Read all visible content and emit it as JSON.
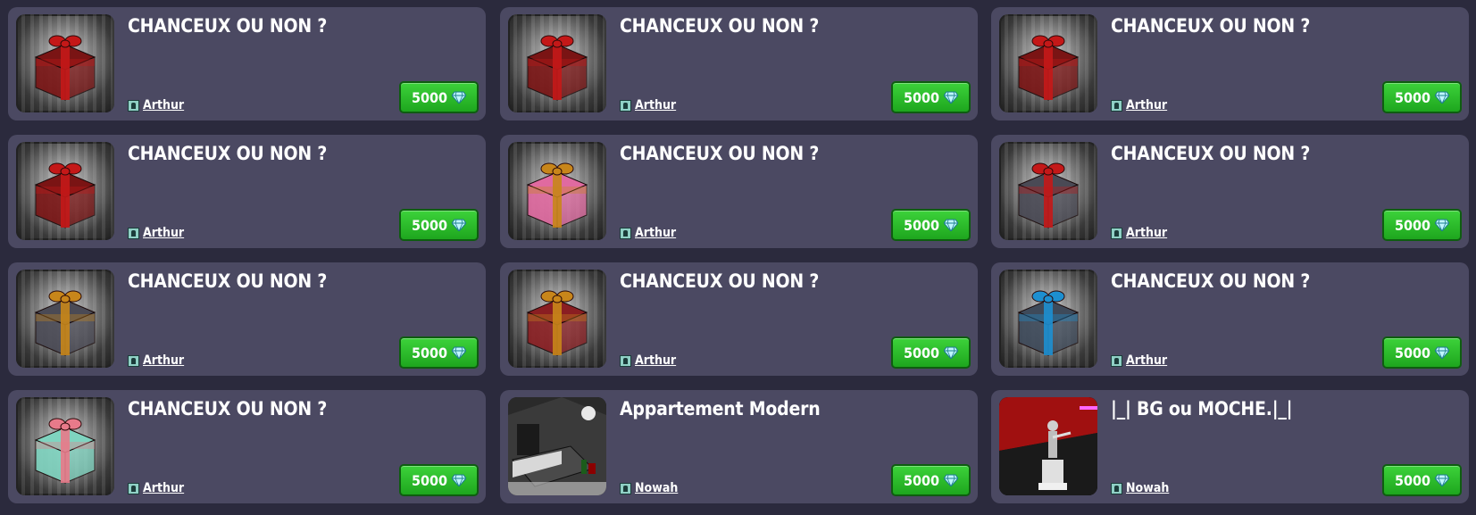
{
  "currency_icon": "diamond-icon",
  "author_icon": "user-icon",
  "cards": [
    {
      "title": "CHANCEUX OU NON ?",
      "author": "Arthur",
      "price": "5000",
      "image": "red-gift-icon",
      "box": "#7a1414",
      "ribbon": "#c41818"
    },
    {
      "title": "CHANCEUX OU NON ?",
      "author": "Arthur",
      "price": "5000",
      "image": "red-gift-icon",
      "box": "#7a1414",
      "ribbon": "#c41818"
    },
    {
      "title": "CHANCEUX OU NON ?",
      "author": "Arthur",
      "price": "5000",
      "image": "red-gift-icon",
      "box": "#7a1414",
      "ribbon": "#c41818"
    },
    {
      "title": "CHANCEUX OU NON ?",
      "author": "Arthur",
      "price": "5000",
      "image": "red-gift-icon",
      "box": "#7a1414",
      "ribbon": "#c41818"
    },
    {
      "title": "CHANCEUX OU NON ?",
      "author": "Arthur",
      "price": "5000",
      "image": "pink-gift-icon",
      "box": "#e06aa0",
      "ribbon": "#c8861a"
    },
    {
      "title": "CHANCEUX OU NON ?",
      "author": "Arthur",
      "price": "5000",
      "image": "grey-gift-icon",
      "box": "#4a4a55",
      "ribbon": "#c41818"
    },
    {
      "title": "CHANCEUX OU NON ?",
      "author": "Arthur",
      "price": "5000",
      "image": "grey-gift-icon",
      "box": "#4a4a55",
      "ribbon": "#c8861a"
    },
    {
      "title": "CHANCEUX OU NON ?",
      "author": "Arthur",
      "price": "5000",
      "image": "red-gift-icon",
      "box": "#8a1e22",
      "ribbon": "#c8861a"
    },
    {
      "title": "CHANCEUX OU NON ?",
      "author": "Arthur",
      "price": "5000",
      "image": "blue-gift-icon",
      "box": "#3e4a5a",
      "ribbon": "#1d8fd0"
    },
    {
      "title": "CHANCEUX OU NON ?",
      "author": "Arthur",
      "price": "5000",
      "image": "green-gift-icon",
      "box": "#7fd4c0",
      "ribbon": "#e87a8a"
    },
    {
      "title": "Appartement Modern",
      "author": "Nowah",
      "price": "5000",
      "image": "room-thumbnail"
    },
    {
      "title": "|_| BG ou MOCHE.|_|",
      "author": "Nowah",
      "price": "5000",
      "image": "room-thumbnail"
    }
  ]
}
